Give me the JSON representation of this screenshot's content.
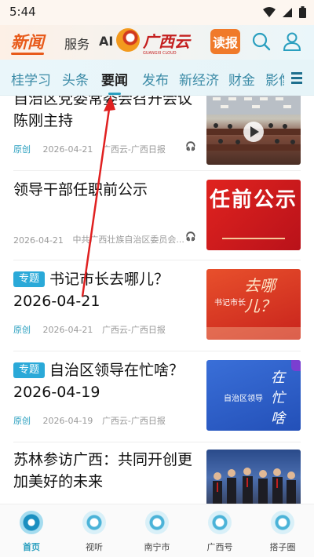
{
  "status_bar": {
    "time": "5:44"
  },
  "header": {
    "news_label": "新闻",
    "service_label": "服务",
    "ai_label": "AI",
    "brand_name": "广西云",
    "brand_sub": "GUANGXI CLOUD",
    "read_label": "读报"
  },
  "tabs": [
    "桂学习",
    "头条",
    "要闻",
    "发布",
    "新经济",
    "财金",
    "影像"
  ],
  "active_tab": "要闻",
  "feed": [
    {
      "title": "自治区党委常委会召开会议陈刚主持",
      "tag": "",
      "meta_orig": "原创",
      "meta_date": "2026-04-21",
      "meta_source": "广西云-广西日报",
      "audio": true,
      "thumb_icon": "play-icon"
    },
    {
      "title": "领导干部任职前公示",
      "tag": "",
      "meta_orig": "",
      "meta_date": "2026-04-21",
      "meta_source": "中共广西壮族自治区委员会...",
      "audio": true,
      "thumb_title": "任前公示"
    },
    {
      "title": "书记市长去哪儿？2026-04-21",
      "tag": "专题",
      "meta_orig": "原创",
      "meta_date": "2026-04-21",
      "meta_source": "广西云-广西日报",
      "audio": false,
      "thumb_big": "去哪儿？",
      "thumb_small": "书记市长"
    },
    {
      "title": "自治区领导在忙啥？2026-04-19",
      "tag": "专题",
      "meta_orig": "原创",
      "meta_date": "2026-04-19",
      "meta_source": "广西云-广西日报",
      "audio": false,
      "thumb_big": "在忙啥",
      "thumb_small": "自治区领导"
    },
    {
      "title": "苏林参访广西：共同开创更加美好的未来",
      "tag": "",
      "meta_orig": "",
      "meta_date": "",
      "meta_source": "",
      "audio": false
    }
  ],
  "bottom_nav": [
    "首页",
    "视听",
    "南宁市",
    "广西号",
    "搭子圈"
  ],
  "colors": {
    "accent": "#2a9fbf",
    "brand": "#e85a1a",
    "red": "#d6201f"
  }
}
